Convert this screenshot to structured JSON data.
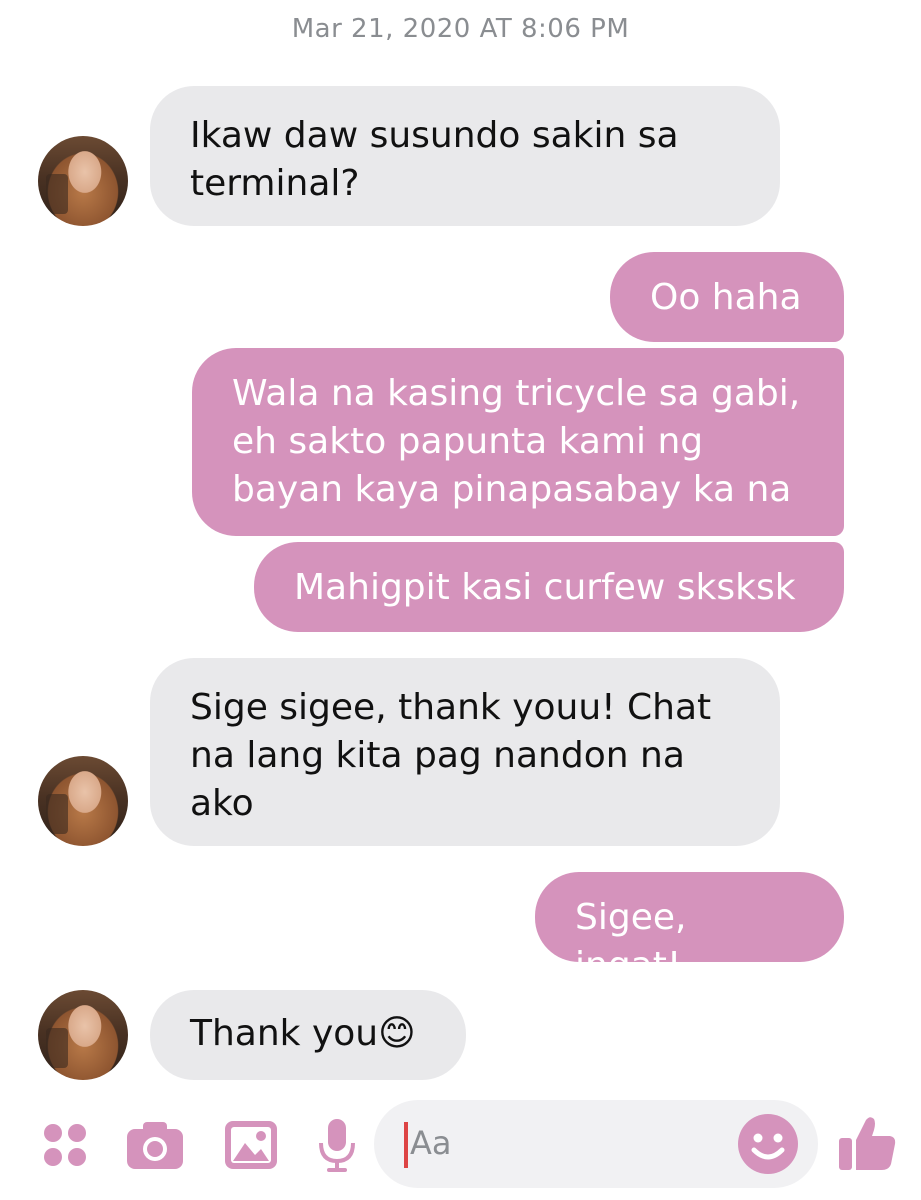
{
  "conversation": {
    "timestamp": "Mar 21, 2020 AT 8:06 PM",
    "messages": [
      {
        "sender": "them",
        "text": "Ikaw daw susundo sakin sa\nterminal?"
      },
      {
        "sender": "me",
        "text": "Oo haha"
      },
      {
        "sender": "me",
        "text": "Wala na kasing tricycle sa gabi,\neh sakto papunta kami ng\nbayan kaya pinapasabay ka na"
      },
      {
        "sender": "me",
        "text": "Mahigpit kasi curfew sksksk"
      },
      {
        "sender": "them",
        "text": "Sige sigee, thank youu! Chat\nna lang kita pag nandon na\nako"
      },
      {
        "sender": "me",
        "text": "Sigee, ingat!"
      },
      {
        "sender": "them",
        "text": "Thank you😊"
      }
    ]
  },
  "composer": {
    "placeholder": "Aa",
    "icons": [
      "apps-icon",
      "camera-icon",
      "image-icon",
      "microphone-icon",
      "emoji-icon",
      "thumbs-up-icon"
    ]
  },
  "colors": {
    "outgoing_bubble": "#d593bc",
    "incoming_bubble": "#e9e9eb",
    "accent": "#d593bc",
    "timestamp_text": "#8a8d91"
  }
}
